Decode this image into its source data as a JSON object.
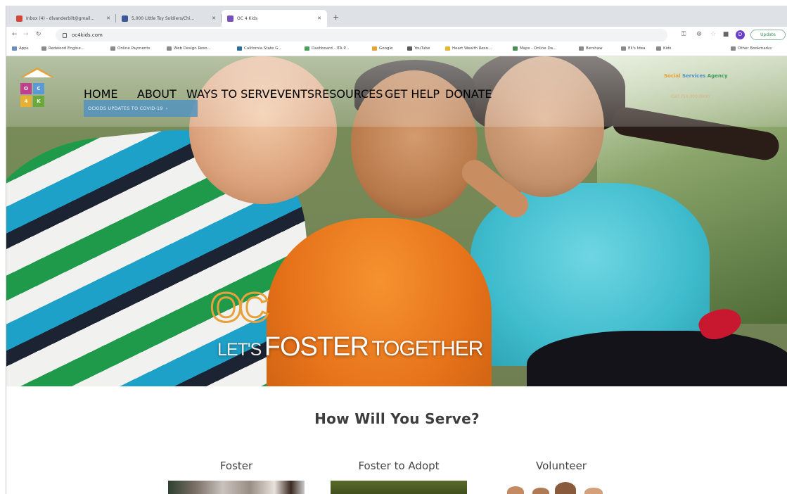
{
  "browser": {
    "tabs": [
      {
        "title": "Inbox (4) - dlvanderbilt@gmail...",
        "active": false,
        "fav_color": "#d44638"
      },
      {
        "title": "5,000 Little Toy Soldiers/Chi...",
        "active": false,
        "fav_color": "#3b5998"
      },
      {
        "title": "OC 4 Kids",
        "active": true,
        "fav_color": "#7a4fb8"
      }
    ],
    "new_tab_glyph": "+",
    "url": "oc4kids.com",
    "profile_initial": "D",
    "update_label": "Update",
    "bookmarks": [
      "Apps",
      "Redwood Engine...",
      "Online Payments",
      "Web Design Reso...",
      "California State G...",
      "Dashboard - ITA P...",
      "Google",
      "YouTube",
      "Heart Wealth Reso...",
      "Maps - Online Da...",
      "Bershaw",
      "Eli's Idea",
      "Kids",
      "Other Bookmarks"
    ]
  },
  "site": {
    "logo_letters": [
      "O",
      "C",
      "4",
      "K"
    ],
    "nav": [
      "HOME",
      "ABOUT",
      "WAYS TO SERVE",
      "EVENTS",
      "RESOURCES",
      "GET HELP",
      "DONATE"
    ],
    "covid_label": "OCKIDS UPDATES TO COVID-19",
    "social": {
      "part1": "Social",
      "part2": "Services",
      "part3": "Agency"
    },
    "sub_nav": "Call 714.000.0000",
    "hero": {
      "oc_mark": "OC",
      "tagline_a": "LET'S",
      "tagline_b": "FOSTER",
      "tagline_c": "TOGETHER"
    },
    "serve_heading": "How Will You Serve?",
    "options": [
      "Foster",
      "Foster to Adopt",
      "Volunteer"
    ]
  },
  "colors": {
    "brand_orange": "#e8802c",
    "brand_gold": "#e7a13a",
    "covid_blue": "#5493be"
  }
}
